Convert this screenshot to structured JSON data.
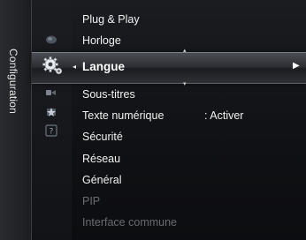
{
  "sidebar": {
    "label": "Configuration"
  },
  "menu": {
    "selected": {
      "label": "Langue",
      "left_arrow": "◂",
      "right_arrow": "▶",
      "up_arrow": "▴",
      "down_arrow": "▾"
    },
    "items_above": [
      {
        "label": "Plug & Play"
      },
      {
        "label": "Horloge"
      }
    ],
    "items_below": [
      {
        "label": "Sous-titres"
      },
      {
        "label": "Texte numérique",
        "value": ": Activer"
      },
      {
        "label": "Sécurité"
      },
      {
        "label": "Réseau"
      },
      {
        "label": "Général"
      },
      {
        "label": "PIP",
        "disabled": true
      },
      {
        "label": "Interface commune",
        "disabled": true
      }
    ]
  },
  "icons": {
    "picture": "picture-icon",
    "setup": "gear-setup-icon",
    "input": "input-icon",
    "application": "application-icon",
    "support": "support-question-icon"
  }
}
